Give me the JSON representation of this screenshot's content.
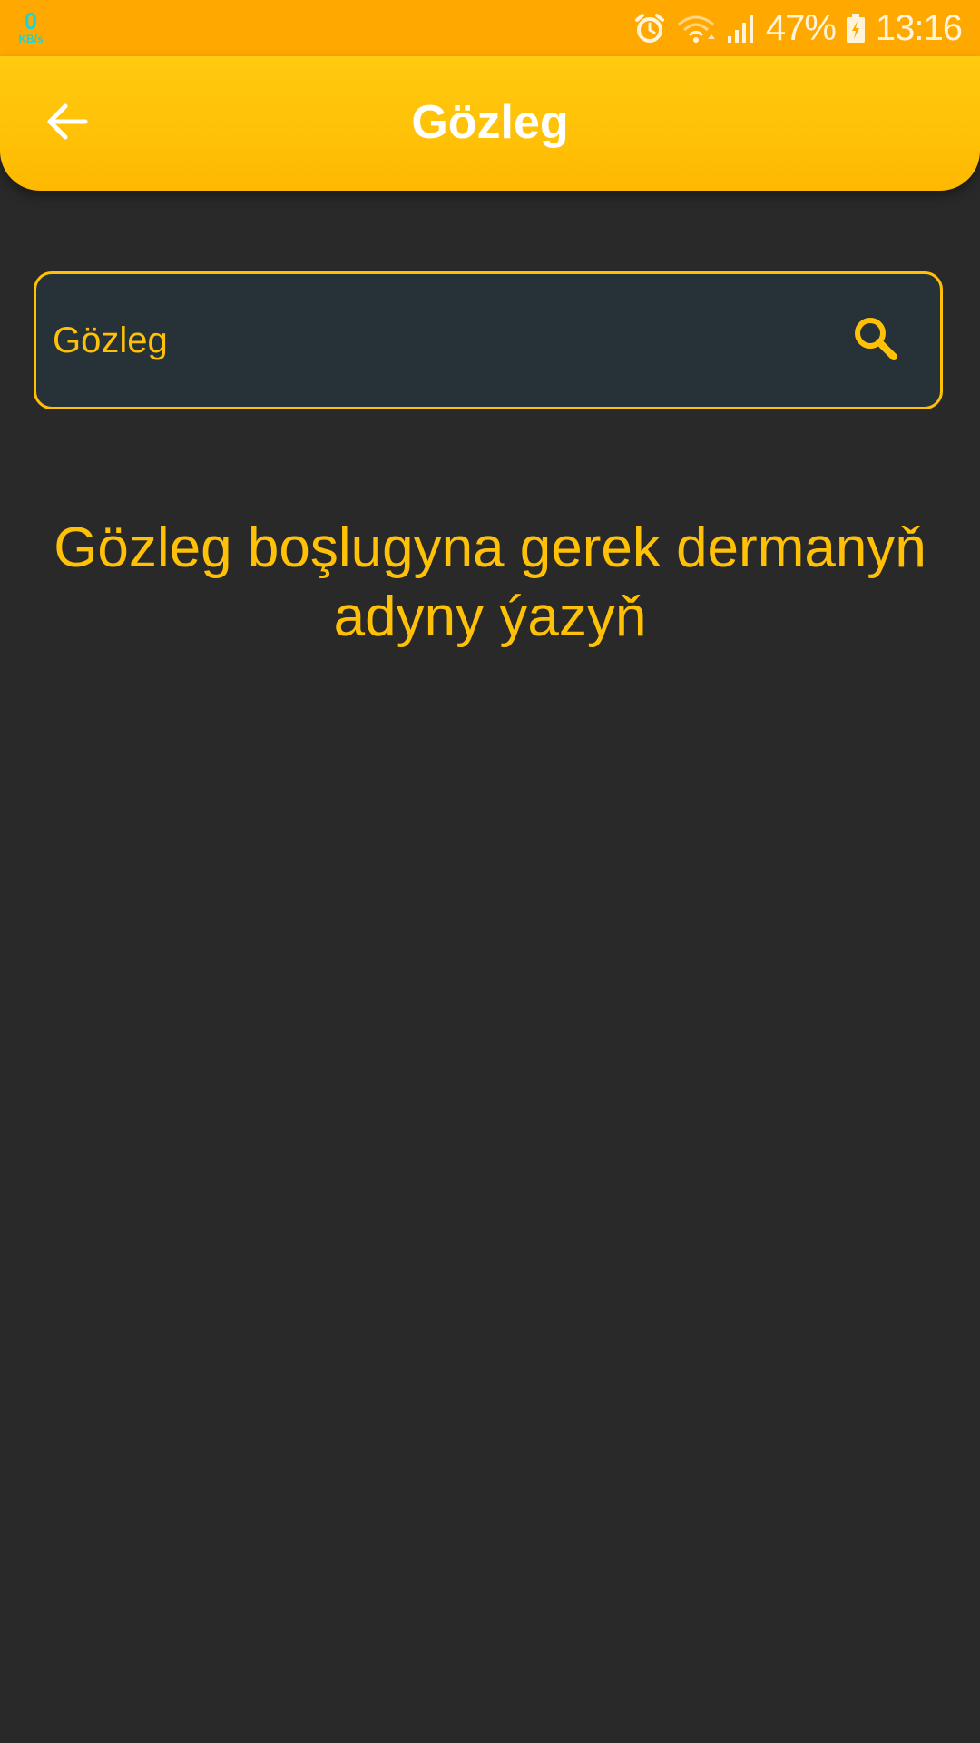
{
  "status_bar": {
    "net_speed_value": "0",
    "net_speed_unit": "KB/s",
    "battery_percent": "47%",
    "time": "13:16",
    "icons": [
      "alarm-icon",
      "wifi-icon",
      "signal-icon",
      "battery-icon"
    ]
  },
  "app_bar": {
    "title": "Gözleg",
    "back_icon": "arrow-left-icon"
  },
  "search": {
    "placeholder": "Gözleg",
    "value": "",
    "icon": "search-icon"
  },
  "main": {
    "empty_message": "Gözleg boşlugyna gerek dermanyň adyny ýazyň"
  },
  "colors": {
    "status_bar": "#ffa800",
    "app_bar": "#ffc107",
    "accent": "#ffc107",
    "background": "#292929",
    "search_field": "#263238"
  }
}
